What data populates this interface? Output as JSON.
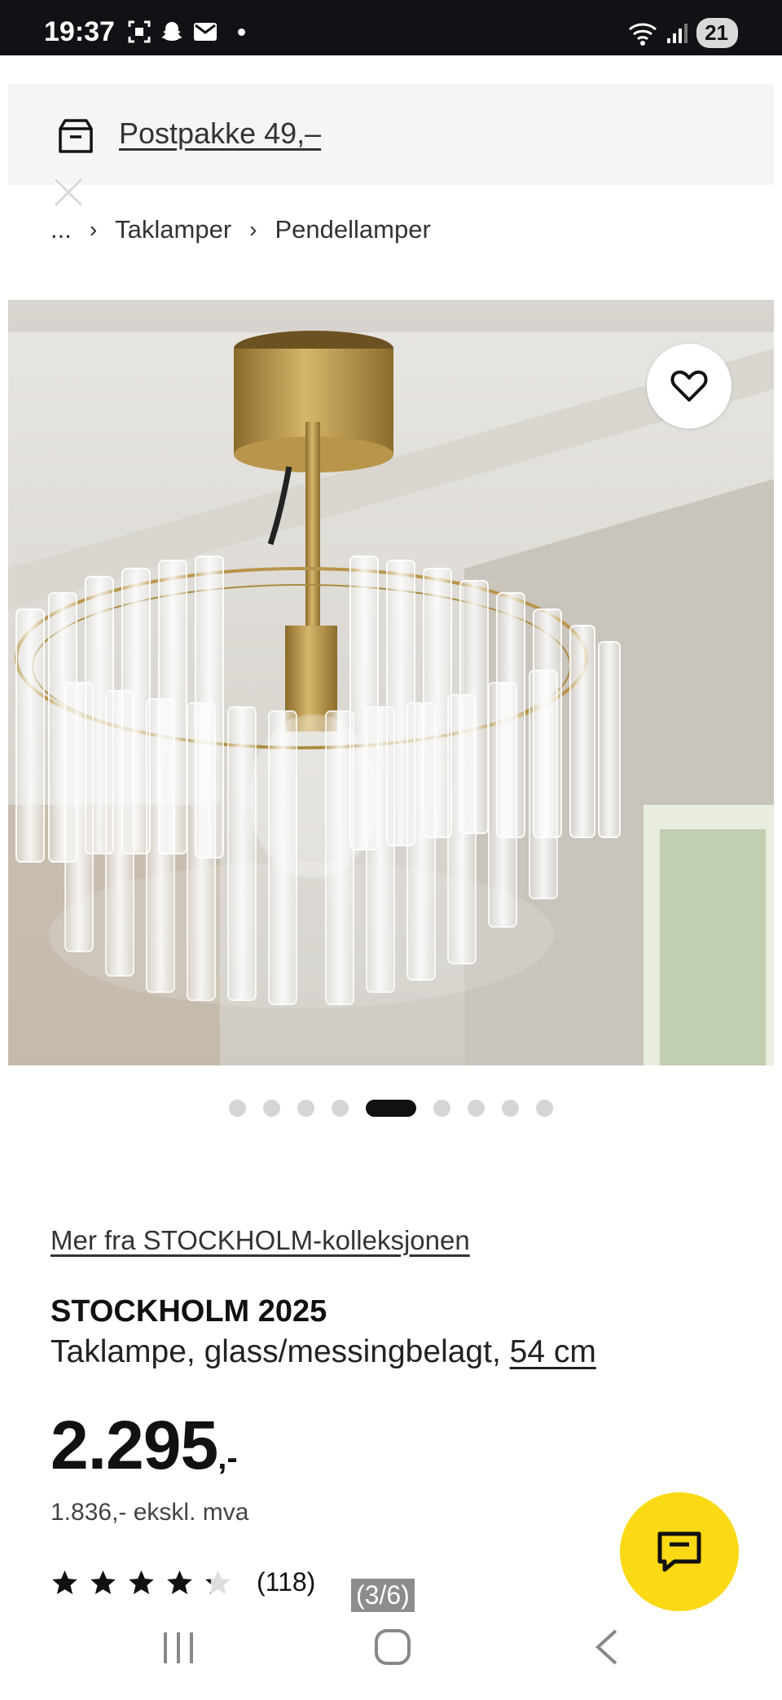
{
  "status_bar": {
    "time": "19:37",
    "battery": "21",
    "icons": [
      "screenshot-icon",
      "snapchat-icon",
      "mail-icon",
      "dot-icon",
      "wifi-icon",
      "signal-icon",
      "battery-icon"
    ]
  },
  "delivery": {
    "label": "Postpakke 49,–"
  },
  "breadcrumb": {
    "items": [
      "...",
      "Taklamper",
      "Pendellamper"
    ]
  },
  "carousel": {
    "count": 9,
    "active_index": 4
  },
  "product": {
    "collection_link": "Mer fra STOCKHOLM-kolleksjonen",
    "name": "STOCKHOLM 2025",
    "description": "Taklampe, glass/messingbelagt, ",
    "size": "54 cm",
    "price": "2.295",
    "price_suffix": ",-",
    "price_excl_vat": "1.836,- ekskl. mva",
    "rating": 4.2,
    "review_count": "(118)"
  },
  "page_counter": "(3/6)",
  "colors": {
    "accent_yellow": "#fbd914",
    "text_dark": "#111111",
    "banner_bg": "#f5f5f5",
    "status_bg": "#111216"
  }
}
